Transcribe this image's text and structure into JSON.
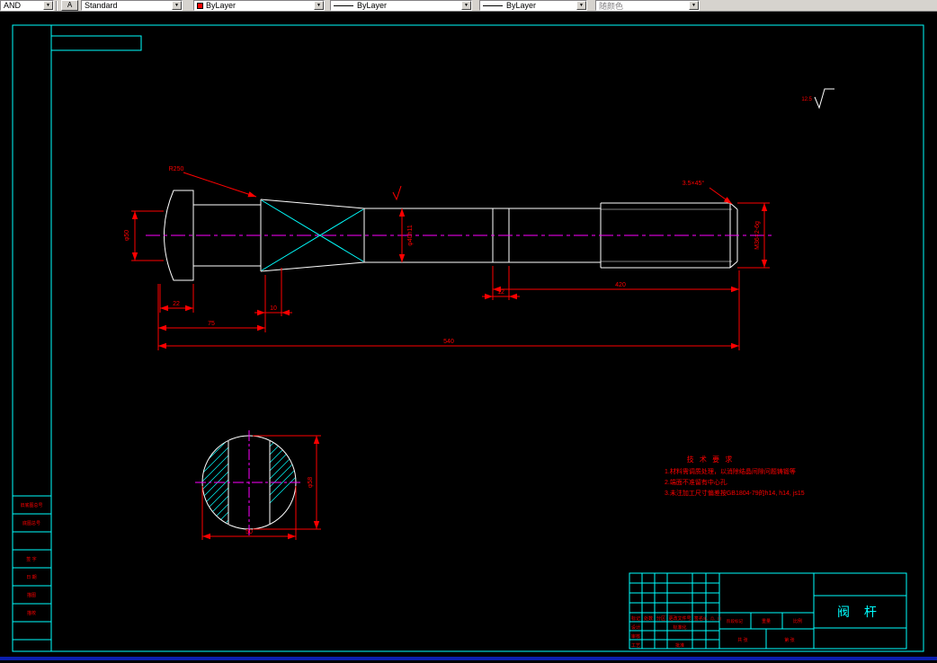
{
  "toolbar": {
    "layer_value": "AND",
    "style_icon": "A",
    "style_value": "Standard",
    "color_value": "ByLayer",
    "linetype_value": "ByLayer",
    "lineweight_value": "ByLayer",
    "plotstyle_value": "随颜色",
    "accent_swatch_color": "#ff0000"
  },
  "drawing": {
    "dims": {
      "flange_width": "22",
      "head_length": "75",
      "taper_len": "10",
      "groove_width": "12",
      "thread_section_length": "420",
      "overall_length": "540",
      "neck_dia": "φ50",
      "shaft_dia": "φ40h11",
      "thread_spec": "M36×2-6g",
      "radius_note": "R250",
      "chamfer_note": "3.5×45°",
      "roughness": "12.5",
      "section_flat_width": "50",
      "section_dia": "φ58"
    },
    "tech_req": {
      "title": "技 术 要 求",
      "items": [
        "1.材料需调质处理，以消除结晶间隙问题铸锻等",
        "2.端面不准留有中心孔.",
        "3.未注加工尺寸偏差按GB1804-79的h14, h14, js15"
      ]
    },
    "title_block": {
      "part_name": "阀  杆",
      "headers": [
        "标记",
        "处数",
        "分区",
        "更改文件号",
        "签名",
        "年、月、日"
      ],
      "roles": [
        "设计",
        "审核",
        "工艺",
        "标准化",
        "批准"
      ],
      "stage": "阶段标记",
      "weight": "重量",
      "scale": "比例",
      "sheet_total": "共  张",
      "sheet_num": "第  张"
    },
    "side_table": {
      "rows": [
        "旧底图总号",
        "底图总号",
        "",
        "签 字",
        "日 期",
        "描图",
        "描校",
        ""
      ]
    },
    "colors": {
      "frame": "#00ffff",
      "geometry": "#ffffff",
      "dimension": "#ff0000",
      "centerline": "#ff00ff"
    }
  }
}
